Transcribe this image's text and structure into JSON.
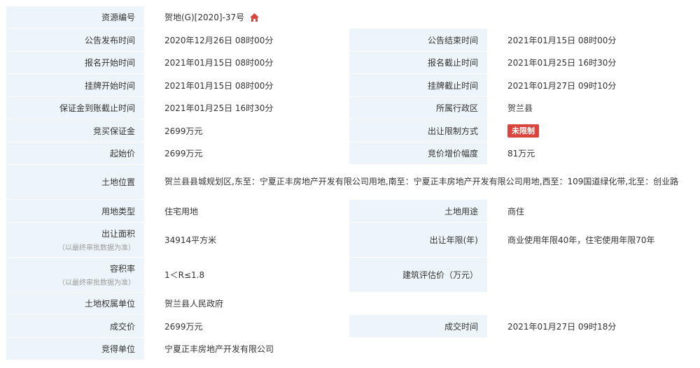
{
  "rows": {
    "resource_no": {
      "label": "资源编号",
      "value": "贺地(G)[2020]-37号"
    },
    "announce_start": {
      "label": "公告发布时间",
      "value": "2020年12月26日 08时00分"
    },
    "announce_end": {
      "label": "公告结束时间",
      "value": "2021年01月15日 08时00分"
    },
    "signup_start": {
      "label": "报名开始时间",
      "value": "2021年01月15日 08时00分"
    },
    "signup_end": {
      "label": "报名截止时间",
      "value": "2021年01月25日 16时30分"
    },
    "listing_start": {
      "label": "挂牌开始时间",
      "value": "2021年01月15日 08时00分"
    },
    "listing_end": {
      "label": "挂牌截止时间",
      "value": "2021年01月27日 09时10分"
    },
    "deposit_deadline": {
      "label": "保证金到账截止时间",
      "value": "2021年01月25日 16时30分"
    },
    "district": {
      "label": "所属行政区",
      "value": "贺兰县"
    },
    "deposit": {
      "label": "竞买保证金",
      "value": "2699万元"
    },
    "restriction": {
      "label": "出让限制方式",
      "value": "未限制"
    },
    "start_price": {
      "label": "起始价",
      "value": "2699万元"
    },
    "increment": {
      "label": "竞价增价幅度",
      "value": "81万元"
    },
    "location": {
      "label": "土地位置",
      "value": "贺兰县县城规划区,东至：宁夏正丰房地产开发有限公司用地,南至：宁夏正丰房地产开发有限公司用地,西至：109国道绿化带,北至：创业路"
    },
    "land_type": {
      "label": "用地类型",
      "value": "住宅用地"
    },
    "land_use": {
      "label": "土地用途",
      "value": "商住"
    },
    "area": {
      "label": "出让面积",
      "note": "（以最终审批数据为准）",
      "value": "34914平方米"
    },
    "term": {
      "label": "出让年限(年)",
      "value": "商业使用年限40年，住宅使用年限70年"
    },
    "far": {
      "label": "容积率",
      "note": "（以最终审批数据为准）",
      "value": "1＜R≤1.8"
    },
    "building_price": {
      "label": "建筑评估价（万元）",
      "value": ""
    },
    "owner": {
      "label": "土地权属单位",
      "value": "贺兰县人民政府"
    },
    "deal_price": {
      "label": "成交价",
      "value": "2699万元"
    },
    "deal_time": {
      "label": "成交时间",
      "value": "2021年01月27日 09时18分"
    },
    "winner": {
      "label": "竞得单位",
      "value": "宁夏正丰房地产开发有限公司"
    }
  },
  "colors": {
    "label_bg": "#eef5fa",
    "badge_bg": "#d9453d",
    "home_icon": "#d9453d"
  },
  "icons": {
    "resource_no_suffix": "home-icon"
  }
}
